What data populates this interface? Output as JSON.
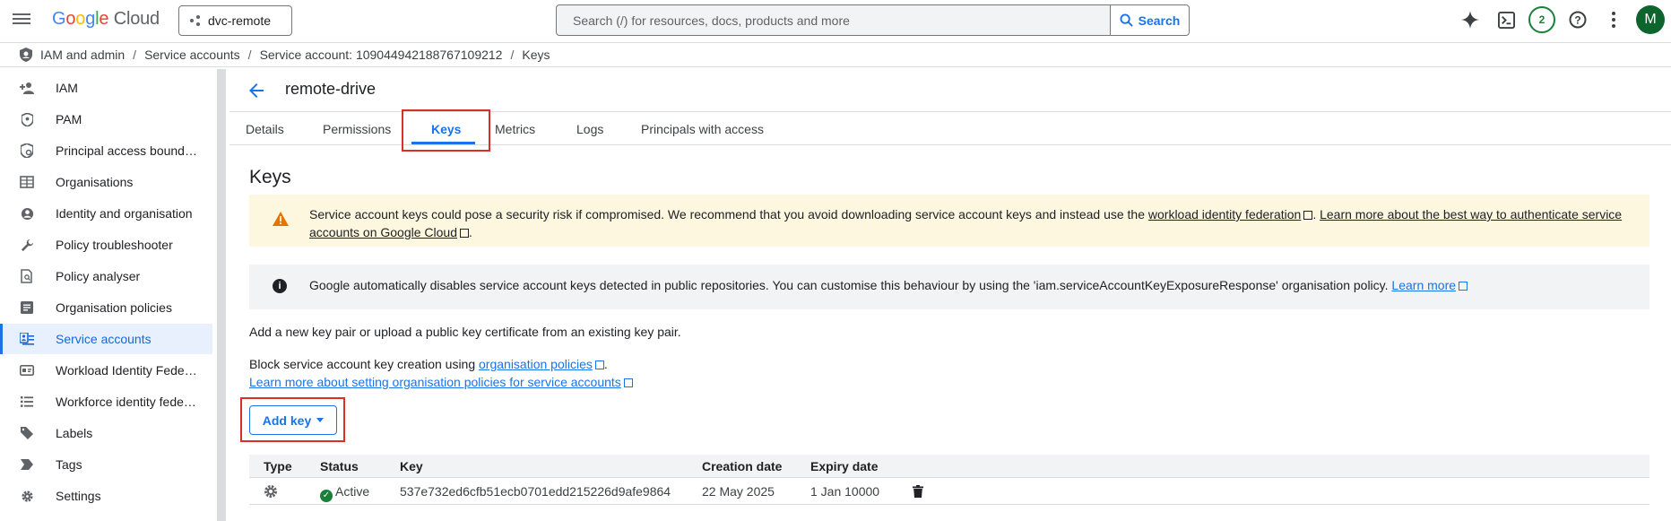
{
  "topbar": {
    "logo_google": [
      "G",
      "o",
      "o",
      "g",
      "l",
      "e"
    ],
    "logo_cloud": "Cloud",
    "project": "dvc-remote",
    "search_placeholder": "Search (/) for resources, docs, products and more",
    "search_button": "Search",
    "notifications_count": "2",
    "avatar_letter": "M"
  },
  "breadcrumb": [
    "IAM and admin",
    "Service accounts",
    "Service account: 109044942188767109212",
    "Keys"
  ],
  "sidebar": {
    "items": [
      {
        "label": "IAM",
        "icon": "person-add-icon"
      },
      {
        "label": "PAM",
        "icon": "shield-icon"
      },
      {
        "label": "Principal access bound…",
        "icon": "policy-shield-icon"
      },
      {
        "label": "Organisations",
        "icon": "building-icon"
      },
      {
        "label": "Identity and organisation",
        "icon": "account-circle-icon"
      },
      {
        "label": "Policy troubleshooter",
        "icon": "wrench-icon"
      },
      {
        "label": "Policy analyser",
        "icon": "document-search-icon"
      },
      {
        "label": "Organisation policies",
        "icon": "article-icon"
      },
      {
        "label": "Service accounts",
        "icon": "service-account-icon",
        "active": true
      },
      {
        "label": "Workload Identity Fede…",
        "icon": "id-card-icon"
      },
      {
        "label": "Workforce identity fede…",
        "icon": "list-icon"
      },
      {
        "label": "Labels",
        "icon": "label-icon"
      },
      {
        "label": "Tags",
        "icon": "tag-icon"
      },
      {
        "label": "Settings",
        "icon": "gear-icon"
      }
    ]
  },
  "header": {
    "title": "remote-drive"
  },
  "tabs": [
    "Details",
    "Permissions",
    "Keys",
    "Metrics",
    "Logs",
    "Principals with access"
  ],
  "main": {
    "section_title": "Keys",
    "warning": {
      "text_1": "Service account keys could pose a security risk if compromised. We recommend that you avoid downloading service account keys and instead use the ",
      "link_1": "workload identity federation",
      "text_2": ". ",
      "link_2": "Learn more about the best way to authenticate service accounts on Google Cloud",
      "text_3": "."
    },
    "info": {
      "text": "Google automatically disables service account keys detected in public repositories. You can customise this behaviour by using the 'iam.serviceAccountKeyExposureResponse' organisation policy. ",
      "link": "Learn more"
    },
    "add_text": "Add a new key pair or upload a public key certificate from an existing key pair.",
    "block_text": "Block service account key creation using ",
    "block_link": "organisation policies",
    "block_end": ".",
    "learn_link": "Learn more about setting organisation policies for service accounts",
    "add_key_button": "Add key"
  },
  "table": {
    "columns": [
      "Type",
      "Status",
      "Key",
      "Creation date",
      "Expiry date"
    ],
    "rows": [
      {
        "type_icon": "gear-key-icon",
        "status": "Active",
        "key": "537e732ed6cfb51ecb0701edd215226d9afe9864",
        "created": "22 May 2025",
        "expiry": "1 Jan 10000"
      }
    ]
  },
  "colors": {
    "accent": "#1a73e8",
    "warning_bg": "#fef7e0",
    "info_bg": "#f1f3f4",
    "highlight": "#d93025",
    "active_status": "#188038"
  }
}
